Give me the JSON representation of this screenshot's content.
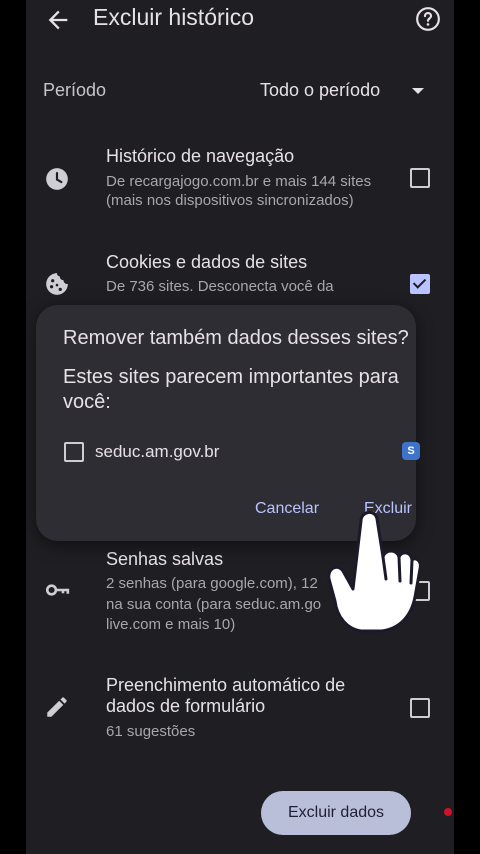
{
  "header": {
    "title": "Excluir histórico"
  },
  "period": {
    "label": "Período",
    "value": "Todo o período"
  },
  "items": [
    {
      "title": "Histórico de navegação",
      "sub1": "De recargajogo.com.br e mais 144 sites",
      "sub2": "(mais nos dispositivos sincronizados)",
      "checked": false
    },
    {
      "title": "Cookies e dados de sites",
      "sub1": "De 736 sites. Desconecta você da",
      "checked": true
    },
    {
      "title": "Senhas salvas",
      "sub1": "2 senhas (para google.com), 12",
      "sub2": "na sua conta (para seduc.am.go",
      "sub3": "live.com e mais 10)",
      "checked": false
    },
    {
      "title1": "Preenchimento automático de",
      "title2": "dados de formulário",
      "sub1": "61 sugestões",
      "checked": false
    }
  ],
  "dialog": {
    "title": "Remover também dados desses sites?",
    "body": "Estes sites parecem importantes para você:",
    "site": "seduc.am.gov.br",
    "favicon_letter": "S",
    "cancel": "Cancelar",
    "confirm": "Excluir"
  },
  "fab": {
    "label": "Excluir dados"
  }
}
